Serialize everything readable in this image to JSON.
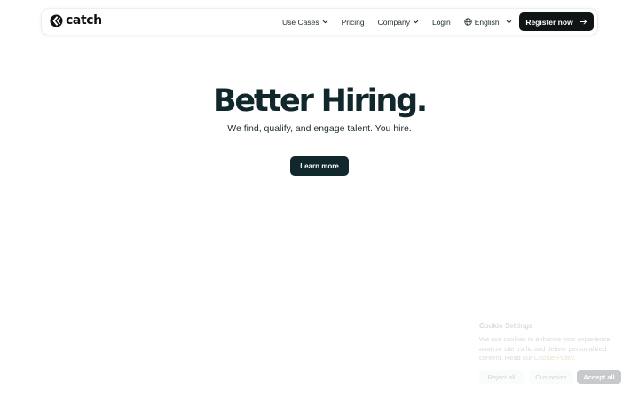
{
  "brand": {
    "name": "catch",
    "logo_icon": "catch-logo-icon"
  },
  "nav": {
    "items": [
      {
        "label": "Use Cases",
        "dropdown": true
      },
      {
        "label": "Pricing",
        "dropdown": false
      },
      {
        "label": "Company",
        "dropdown": true
      },
      {
        "label": "Login",
        "dropdown": false
      }
    ],
    "language": {
      "label": "English",
      "icon": "globe-icon"
    },
    "register_label": "Register now"
  },
  "hero": {
    "title": "Better Hiring.",
    "subtitle": "We find, qualify, and engage talent. You hire.",
    "cta_label": "Learn more"
  },
  "cookie_banner": {
    "title": "Cookie Settings",
    "body": "We use cookies to enhance your experience, analyze site traffic and deliver personalized content. Read our",
    "link_label": "Cookie Policy.",
    "reject_label": "Reject all",
    "customize_label": "Customize",
    "accept_label": "Accept all"
  },
  "colors": {
    "primary_dark": "#10272b",
    "button_black": "#0f1414",
    "text": "#1d2a2e"
  }
}
